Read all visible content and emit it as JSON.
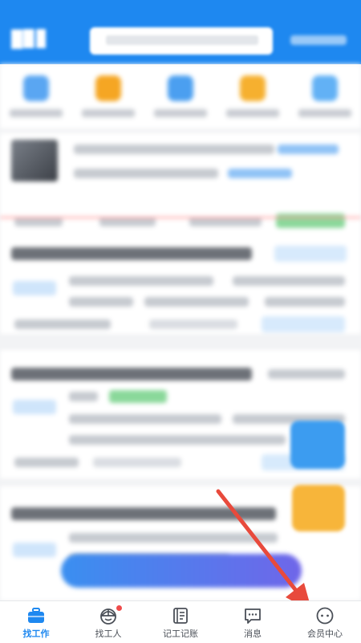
{
  "colors": {
    "brand": "#1e88f0",
    "inactive": "#4a4f57",
    "badge": "#ef4b4b",
    "arrow": "#e84a3c"
  },
  "tabbar": {
    "tabs": [
      {
        "label": "找工作",
        "icon": "briefcase-icon",
        "active": true
      },
      {
        "label": "找工人",
        "icon": "worker-helmet-icon",
        "badge": true
      },
      {
        "label": "记工记账",
        "icon": "ledger-book-icon"
      },
      {
        "label": "消息",
        "icon": "message-bubble-icon"
      },
      {
        "label": "会员中心",
        "icon": "member-face-icon"
      }
    ]
  },
  "annotation": {
    "icon": "red-arrow-icon",
    "points_to": "tab-member-center"
  }
}
